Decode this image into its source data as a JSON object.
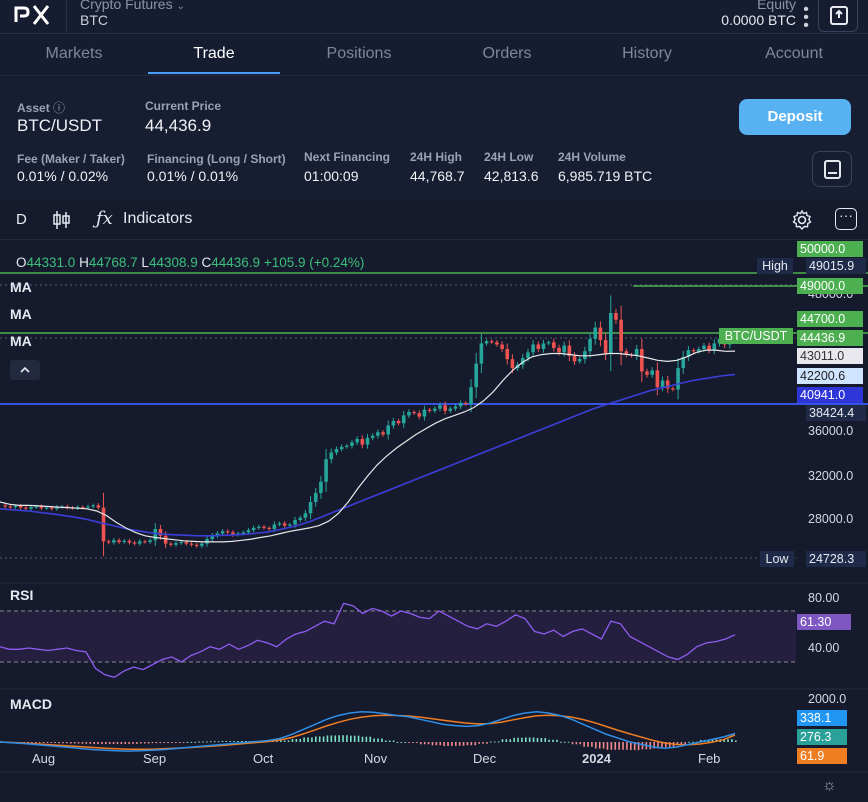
{
  "header": {
    "market_type": "Crypto Futures",
    "symbol": "BTC",
    "equity_label": "Equity",
    "equity_value": "0.0000 BTC"
  },
  "tabs": [
    "Markets",
    "Trade",
    "Positions",
    "Orders",
    "History",
    "Account"
  ],
  "active_tab": "Trade",
  "info": {
    "asset_label": "Asset",
    "asset_value": "BTC/USDT",
    "price_label": "Current Price",
    "price_value": "44,436.9",
    "deposit_label": "Deposit",
    "stats": [
      {
        "label": "Fee (Maker / Taker)",
        "value": "0.01% / 0.02%"
      },
      {
        "label": "Financing (Long / Short)",
        "value": "0.01% / 0.01%"
      },
      {
        "label": "Next Financing",
        "value": "01:00:09"
      },
      {
        "label": "24H High",
        "value": "44,768.7"
      },
      {
        "label": "24H Low",
        "value": "42,813.6"
      },
      {
        "label": "24H Volume",
        "value": "6,985.719 BTC"
      }
    ]
  },
  "toolbar": {
    "interval": "D",
    "indicators_label": "Indicators"
  },
  "ohlc": {
    "o_key": "O",
    "o_val": "44331.0",
    "h_key": "H",
    "h_val": "44768.7",
    "l_key": "L",
    "l_val": "44308.9",
    "c_key": "C",
    "c_val": "44436.9",
    "change": "+105.9 (+0.24%)"
  },
  "ma_labels": [
    "MA",
    "MA",
    "MA"
  ],
  "price_axis": [
    "48000.0",
    "36000.0",
    "32000.0",
    "28000.0"
  ],
  "price_tags": {
    "top": "50000.0",
    "high_label": "High",
    "high_val": "49015.9",
    "line1": "49000.0",
    "line2": "44700.0",
    "symbol_tag": "BTC/USDT",
    "current": "44436.9",
    "ma1": "43011.0",
    "ma2": "42200.6",
    "ma3": "40941.0",
    "line3": "38424.4",
    "low_label": "Low",
    "low_val": "24728.3"
  },
  "rsi": {
    "label": "RSI",
    "axis": [
      "80.00",
      "40.00"
    ],
    "value": "61.30"
  },
  "macd": {
    "label": "MACD",
    "axis": [
      "2000.0"
    ],
    "values": [
      "338.1",
      "276.3",
      "61.9"
    ]
  },
  "x_axis": [
    "Aug",
    "Sep",
    "Oct",
    "Nov",
    "Dec",
    "2024",
    "Feb"
  ],
  "colors": {
    "up": "#26a69a",
    "down": "#ef5350",
    "ma_fast": "#e8e8e8",
    "ma_slow": "#3b3fd8",
    "hline_green": "#4caf50",
    "hline_blue": "#3a5bff",
    "rsi": "#8e5cf0",
    "macd_line": "#2f8ee6",
    "signal_line": "#ef7d22"
  },
  "chart_data": {
    "type": "candlestick",
    "x_labels": [
      "Aug",
      "Sep",
      "Oct",
      "Nov",
      "Dec",
      "2024",
      "Feb"
    ],
    "ylim": [
      24000,
      50000
    ],
    "price_series": [
      29300,
      29200,
      29150,
      29250,
      29100,
      29000,
      29150,
      29200,
      29050,
      29100,
      29000,
      29150,
      29200,
      29100,
      29050,
      29150,
      29100,
      29200,
      29300,
      29100,
      26100,
      26000,
      26200,
      26050,
      26150,
      26000,
      25900,
      26100,
      26050,
      26200,
      27200,
      26600,
      25900,
      25800,
      25950,
      26050,
      25900,
      25800,
      25700,
      25900,
      26300,
      26600,
      26800,
      27000,
      26900,
      26700,
      26800,
      26900,
      27100,
      27300,
      27400,
      27300,
      27200,
      27600,
      27700,
      27500,
      27600,
      28000,
      28200,
      28600,
      29600,
      30400,
      31400,
      33400,
      34000,
      34300,
      34500,
      34600,
      34900,
      35200,
      34700,
      35300,
      35500,
      35800,
      35600,
      36400,
      36800,
      36600,
      37300,
      37600,
      37500,
      37200,
      37800,
      37700,
      37900,
      38200,
      37700,
      37900,
      38100,
      38400,
      38300,
      39800,
      41900,
      43700,
      43900,
      43800,
      43600,
      43200,
      42300,
      41500,
      41800,
      42400,
      42900,
      43600,
      43200,
      43700,
      43800,
      43300,
      42900,
      43500,
      42600,
      42100,
      42300,
      43000,
      44100,
      45100,
      44000,
      42800,
      46400,
      45800,
      43000,
      42700,
      42600,
      43200,
      41200,
      40900,
      41300,
      39800,
      40400,
      39700,
      39600,
      41500,
      42500,
      43100,
      43000,
      43200,
      43500,
      43100,
      43700,
      44100,
      43600,
      44200,
      44436.9
    ],
    "ma_fast": [
      29600,
      29400,
      29300,
      29300,
      29250,
      29200,
      29150,
      29100,
      29050,
      29000,
      28800,
      28400,
      27800,
      27300,
      26900,
      26600,
      26450,
      26350,
      26250,
      26150,
      26100,
      26050,
      26050,
      26050,
      26100,
      26200,
      26300,
      26450,
      26600,
      26800,
      27000,
      27150,
      27300,
      27500,
      27900,
      28600,
      29600,
      30800,
      31900,
      32900,
      33700,
      34400,
      35000,
      35600,
      36100,
      36600,
      37000,
      37300,
      37600,
      38000,
      38600,
      39400,
      40400,
      41300,
      42000,
      42500,
      42700,
      42800,
      42800,
      42700,
      42600,
      42600,
      42700,
      42800,
      42800,
      42700,
      42600,
      42400,
      42200,
      42100,
      42200,
      42500,
      42900,
      43100,
      43100,
      43000,
      43011
    ],
    "ma_slow": [
      29000,
      28900,
      28800,
      28650,
      28500,
      28300,
      28100,
      27800,
      27500,
      27200,
      27000,
      26800,
      26700,
      26650,
      26600,
      26600,
      26650,
      26700,
      26800,
      26950,
      27200,
      27500,
      27900,
      28400,
      28900,
      29400,
      29900,
      30400,
      30900,
      31400,
      31900,
      32400,
      32900,
      33400,
      33900,
      34400,
      34900,
      35400,
      35900,
      36400,
      36900,
      37400,
      37900,
      38300,
      38700,
      39100,
      39500,
      39800,
      40100,
      40400,
      40600,
      40800,
      40941
    ],
    "rsi": [
      52,
      50,
      50,
      51,
      50,
      49,
      50,
      51,
      49,
      48,
      35,
      30,
      28,
      33,
      36,
      34,
      38,
      42,
      44,
      40,
      45,
      48,
      52,
      50,
      54,
      50,
      53,
      57,
      55,
      52,
      58,
      62,
      64,
      68,
      72,
      70,
      86,
      84,
      78,
      82,
      80,
      76,
      80,
      78,
      75,
      74,
      80,
      76,
      72,
      68,
      66,
      70,
      68,
      72,
      77,
      74,
      64,
      62,
      65,
      60,
      64,
      66,
      62,
      58,
      72,
      70,
      60,
      56,
      52,
      48,
      44,
      42,
      46,
      52,
      55,
      56,
      58,
      61.3
    ],
    "macd": [
      0,
      -30,
      -60,
      -100,
      -140,
      -180,
      -220,
      -260,
      -300,
      -330,
      -350,
      -360,
      -350,
      -330,
      -300,
      -260,
      -220,
      -180,
      -140,
      -100,
      -60,
      -20,
      20,
      60,
      140,
      300,
      500,
      700,
      900,
      1050,
      1150,
      1200,
      1180,
      1120,
      1050,
      1000,
      900,
      800,
      700,
      650,
      620,
      650,
      750,
      900,
      1050,
      1150,
      1200,
      1150,
      1050,
      900,
      700,
      500,
      300,
      150,
      0,
      -100,
      -200,
      -250,
      -200,
      -100,
      0,
      100,
      200,
      338.1
    ],
    "signal": [
      0,
      -20,
      -40,
      -70,
      -100,
      -130,
      -160,
      -190,
      -220,
      -250,
      -270,
      -285,
      -290,
      -285,
      -270,
      -250,
      -225,
      -200,
      -170,
      -140,
      -100,
      -60,
      -20,
      20,
      80,
      180,
      320,
      480,
      640,
      780,
      900,
      990,
      1040,
      1060,
      1050,
      1030,
      990,
      930,
      860,
      800,
      750,
      720,
      730,
      790,
      880,
      970,
      1040,
      1060,
      1040,
      990,
      890,
      760,
      610,
      460,
      320,
      190,
      60,
      -40,
      -100,
      -110,
      -80,
      -10,
      90,
      276.3
    ],
    "macd_hist_last": 61.9
  }
}
